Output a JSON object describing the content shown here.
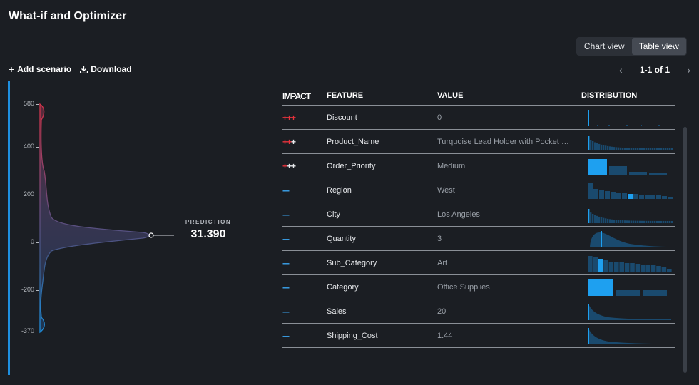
{
  "header": {
    "title": "What-if and Optimizer"
  },
  "view_toggle": {
    "chart_label": "Chart view",
    "table_label": "Table view",
    "active": "table"
  },
  "actions": {
    "add_scenario": "Add scenario",
    "download": "Download"
  },
  "pager": {
    "text": "1-1 of 1"
  },
  "prediction": {
    "label": "PREDICTION",
    "value": "31.390"
  },
  "chart_data": {
    "type": "area",
    "title": "",
    "y_ticks": [
      "580",
      "400",
      "200",
      "0",
      "-200",
      "-370"
    ],
    "ylim": [
      -370,
      580
    ],
    "prediction": 31.39
  },
  "table": {
    "columns": [
      "IMPACT",
      "FEATURE",
      "VALUE",
      "DISTRIBUTION"
    ],
    "rows": [
      {
        "impact": "+++",
        "impact_colors": [
          "#e8323c",
          "#e8323c",
          "#e8323c"
        ],
        "feature": "Discount",
        "value": "0"
      },
      {
        "impact": "+++",
        "impact_colors": [
          "#e8323c",
          "#e8323c",
          "#e6e8eb"
        ],
        "feature": "Product_Name",
        "value": "Turquoise Lead Holder with Pocket …"
      },
      {
        "impact": "+++",
        "impact_colors": [
          "#e8323c",
          "#e6e8eb",
          "#e6e8eb"
        ],
        "feature": "Order_Priority",
        "value": "Medium"
      },
      {
        "impact": "---",
        "impact_colors": [
          "#3aa0e8",
          "#3aa0e8",
          "#3aa0e8"
        ],
        "feature": "Region",
        "value": "West"
      },
      {
        "impact": "---",
        "impact_colors": [
          "#3aa0e8",
          "#3aa0e8",
          "#3aa0e8"
        ],
        "feature": "City",
        "value": "Los Angeles"
      },
      {
        "impact": "---",
        "impact_colors": [
          "#3aa0e8",
          "#3aa0e8",
          "#3aa0e8"
        ],
        "feature": "Quantity",
        "value": "3"
      },
      {
        "impact": "---",
        "impact_colors": [
          "#3aa0e8",
          "#3aa0e8",
          "#3aa0e8"
        ],
        "feature": "Sub_Category",
        "value": "Art"
      },
      {
        "impact": "---",
        "impact_colors": [
          "#3aa0e8",
          "#3aa0e8",
          "#3aa0e8"
        ],
        "feature": "Category",
        "value": "Office Supplies"
      },
      {
        "impact": "---",
        "impact_colors": [
          "#3aa0e8",
          "#3aa0e8",
          "#3aa0e8"
        ],
        "feature": "Sales",
        "value": "20"
      },
      {
        "impact": "---",
        "impact_colors": [
          "#3aa0e8",
          "#3aa0e8",
          "#3aa0e8"
        ],
        "feature": "Shipping_Cost",
        "value": "1.44"
      }
    ]
  },
  "colors": {
    "accent": "#1e8fe0",
    "positive": "#e8323c",
    "negative": "#3aa0e8",
    "bar": "#1a4a6e",
    "bar_highlight": "#1ea0f0"
  }
}
